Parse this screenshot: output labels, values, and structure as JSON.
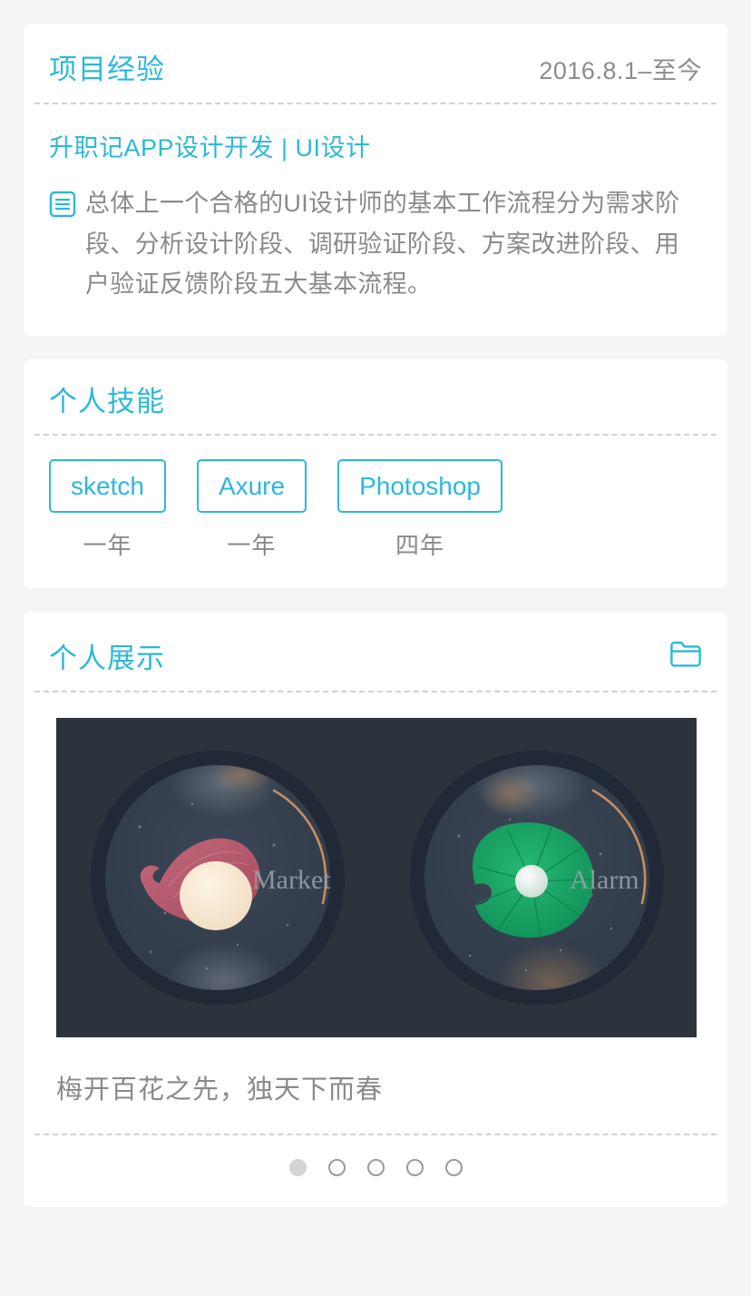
{
  "theme": {
    "accent": "#2db8d8",
    "page_bg": "#f4f5f7",
    "card_bg": "#ffffff",
    "muted_text": "#8a8a8a",
    "figure_bg": "#2d333d"
  },
  "project_card": {
    "title": "项目经验",
    "date_range": "2016.8.1–至今",
    "entry_title": "升职记APP设计开发 | UI设计",
    "description_icon": "document-list-icon",
    "description": "总体上一个合格的UI设计师的基本工作流程分为需求阶段、分析设计阶段、调研验证阶段、方案改进阶段、用户验证反馈阶段五大基本流程。"
  },
  "skills_card": {
    "title": "个人技能",
    "skills": [
      {
        "name": "sketch",
        "years": "一年"
      },
      {
        "name": "Axure",
        "years": "一年"
      },
      {
        "name": "Photoshop",
        "years": "四年"
      }
    ]
  },
  "showcase_card": {
    "title": "个人展示",
    "action_icon": "folder-icon",
    "figure": {
      "left_watch": {
        "label": "Market",
        "motif": "plum-blossom-petal",
        "motif_color": "#b9566a",
        "accent_arc_color": "#c98d5e"
      },
      "right_watch": {
        "label": "Alarm",
        "motif": "lotus-leaf",
        "motif_color": "#1aa863",
        "accent_arc_color": "#c98d5e"
      }
    },
    "caption": "梅开百花之先，独天下而春",
    "carousel": {
      "total": 5,
      "active_index": 0
    }
  }
}
